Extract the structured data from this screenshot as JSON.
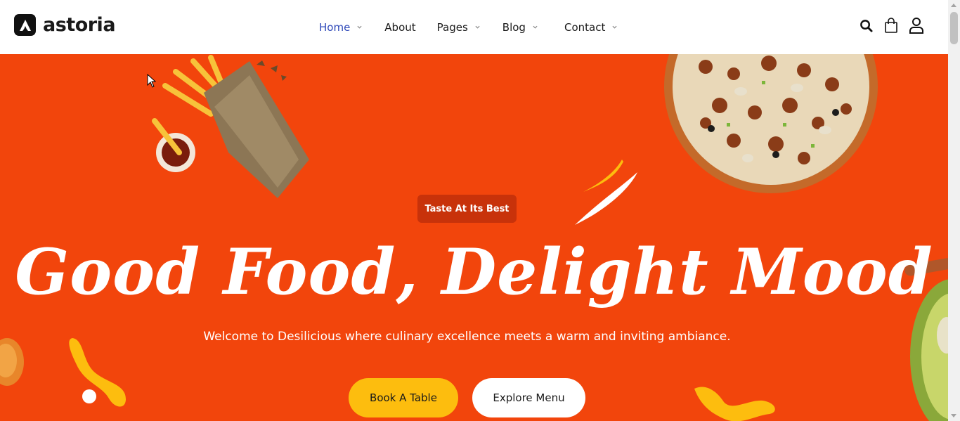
{
  "brand": {
    "name": "astoria"
  },
  "nav": {
    "items": [
      {
        "label": "Home",
        "has_dropdown": true,
        "active": true
      },
      {
        "label": "About",
        "has_dropdown": false,
        "active": false
      },
      {
        "label": "Pages",
        "has_dropdown": true,
        "active": false
      },
      {
        "label": "Blog",
        "has_dropdown": true,
        "active": false
      },
      {
        "label": "Contact",
        "has_dropdown": true,
        "active": false
      }
    ]
  },
  "header_icons": [
    "search-icon",
    "cart-icon",
    "user-icon"
  ],
  "hero": {
    "badge": "Taste At Its Best",
    "headline": "Good Food, Delight Mood",
    "subtitle": "Welcome to Desilicious where culinary excellence meets a warm and inviting ambiance.",
    "primary_button": "Book A Table",
    "secondary_button": "Explore Menu"
  },
  "colors": {
    "hero_bg": "#f2450c",
    "badge_bg": "#c8320a",
    "accent_yellow": "#fdbd0e",
    "nav_active": "#2f49b9"
  }
}
